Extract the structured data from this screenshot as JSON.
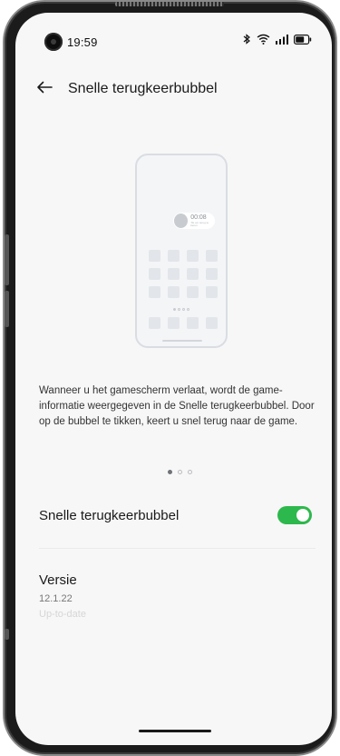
{
  "status_bar": {
    "time": "19:59",
    "icons": [
      "bluetooth-icon",
      "wifi-icon",
      "signal-icon",
      "battery-icon"
    ]
  },
  "app_bar": {
    "back_icon": "arrow-left-icon",
    "title": "Snelle terugkeerbubbel"
  },
  "illustration": {
    "bubble_time": "00:08",
    "bubble_sub": "Tik om terug te keren"
  },
  "description": "Wanneer u het gamescherm verlaat, wordt de game-informatie weergegeven in de Snelle terugkeerbubbel. Door op de bubbel te tikken, keert u snel terug naar de game.",
  "carousel": {
    "count": 3,
    "active_index": 0
  },
  "settings": {
    "toggle_label": "Snelle terugkeerbubbel",
    "toggle_on": true,
    "accent_color": "#2db84d"
  },
  "version": {
    "title": "Versie",
    "number": "12.1.22",
    "status": "Up-to-date"
  }
}
